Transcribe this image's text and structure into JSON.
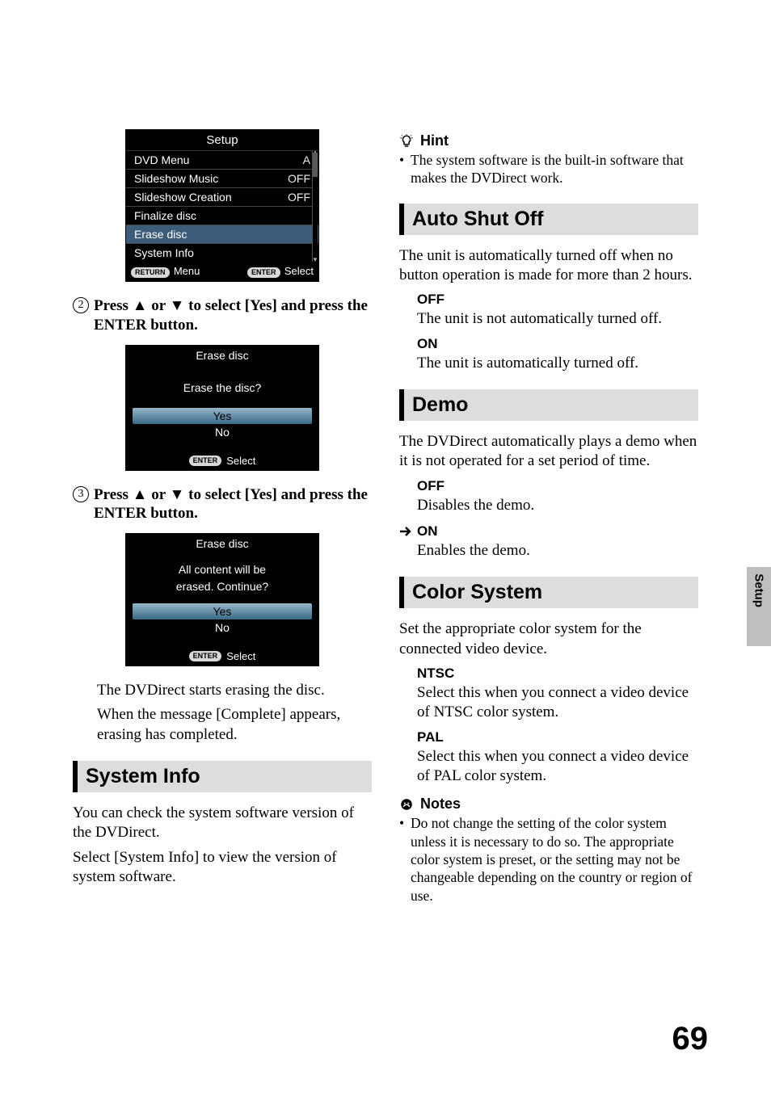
{
  "sidetab": "Setup",
  "page_number": "69",
  "left": {
    "screen_setup": {
      "title": "Setup",
      "rows": [
        {
          "label": "DVD  Menu",
          "value": "A"
        },
        {
          "label": "Slideshow  Music",
          "value": "OFF"
        },
        {
          "label": "Slideshow  Creation",
          "value": "OFF"
        },
        {
          "label": "Finalize  disc",
          "value": ""
        },
        {
          "label": "Erase  disc",
          "value": ""
        },
        {
          "label": "System  Info",
          "value": ""
        }
      ],
      "footer_left_pill": "RETURN",
      "footer_left_label": "Menu",
      "footer_right_pill": "ENTER",
      "footer_right_label": "Select"
    },
    "step2": {
      "num": "2",
      "text_before": "Press ",
      "text_mid": " or ",
      "text_after": " to select [Yes] and press the ENTER button."
    },
    "dialog1": {
      "title": "Erase  disc",
      "prompt": "Erase  the  disc?",
      "yes": "Yes",
      "no": "No",
      "footer_pill": "ENTER",
      "footer_label": "Select"
    },
    "step3": {
      "num": "3",
      "text_before": "Press ",
      "text_mid": " or ",
      "text_after": " to select [Yes] and press the ENTER button."
    },
    "dialog2": {
      "title": "Erase  disc",
      "prompt_l1": "All  content  will  be",
      "prompt_l2": "erased.  Continue?",
      "yes": "Yes",
      "no": "No",
      "footer_pill": "ENTER",
      "footer_label": "Select"
    },
    "para1": "The DVDirect starts erasing the disc.",
    "para2": "When the message [Complete] appears, erasing has completed.",
    "system_info_head": "System Info",
    "system_info_p1": "You can check the system software version of the DVDirect.",
    "system_info_p2": "Select [System Info] to view the version of system software."
  },
  "right": {
    "hint_label": "Hint",
    "hint_bullet": "The system software is the built-in software that makes the DVDirect work.",
    "autoshutoff_head": "Auto Shut Off",
    "autoshutoff_body": "The unit is automatically turned off when no button operation is made for more than 2 hours.",
    "autoshutoff_opts": {
      "off_label": "OFF",
      "off_desc": "The unit is not automatically turned off.",
      "on_label": "ON",
      "on_desc": "The unit is automatically turned off."
    },
    "demo_head": "Demo",
    "demo_body": "The DVDirect automatically plays a demo when it is not operated for a set period of time.",
    "demo_opts": {
      "off_label": "OFF",
      "off_desc": "Disables the demo.",
      "on_label": "ON",
      "on_desc": "Enables the demo."
    },
    "colorsystem_head": "Color System",
    "colorsystem_body": "Set the appropriate color system for the connected video device.",
    "colorsystem_opts": {
      "ntsc_label": "NTSC",
      "ntsc_desc": "Select this when you connect a video device of NTSC color system.",
      "pal_label": "PAL",
      "pal_desc": "Select this when you connect a video device of PAL color system."
    },
    "notes_label": "Notes",
    "notes_bullet": "Do not change the setting of the color system unless it is necessary to do so. The appropriate color system is preset, or the setting may not be changeable depending on the country or region of use."
  }
}
